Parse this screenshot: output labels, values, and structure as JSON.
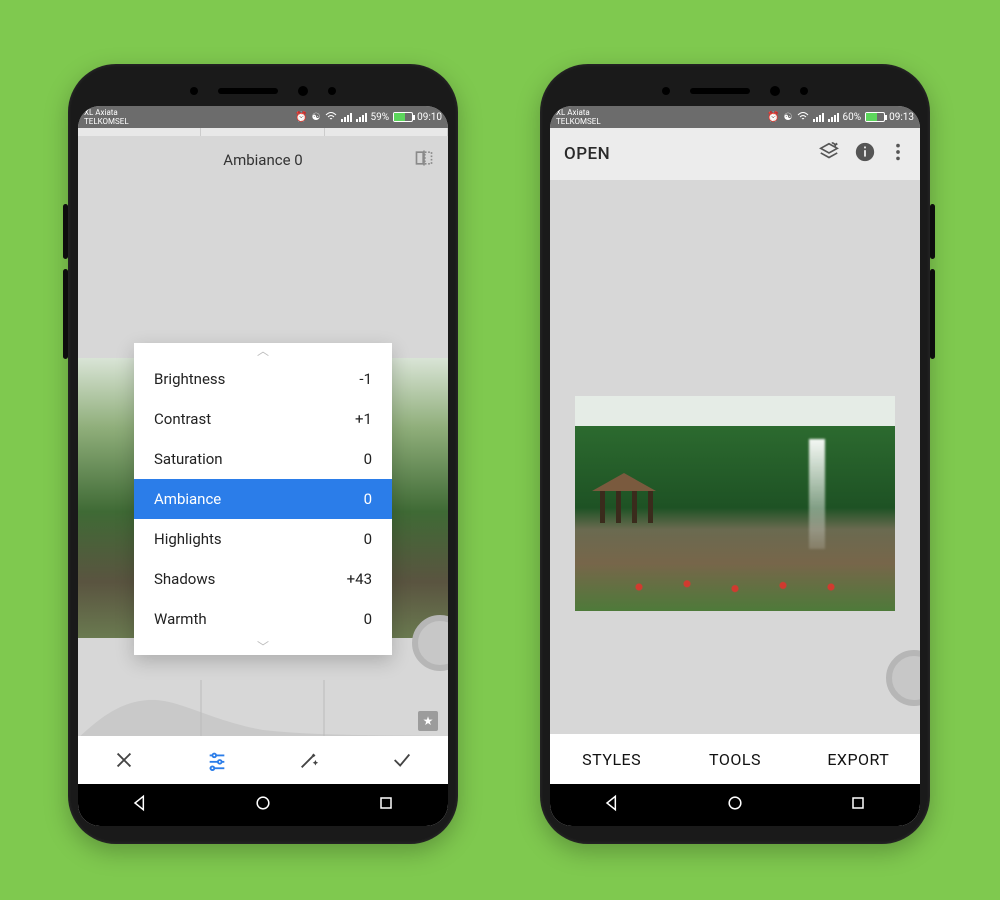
{
  "left": {
    "status": {
      "carrier1": "XL Axiata",
      "carrier2": "TELKOMSEL",
      "battery": "59%",
      "time": "09:10"
    },
    "header": {
      "title": "Ambiance 0"
    },
    "params": [
      {
        "label": "Brightness",
        "value": "-1",
        "selected": false
      },
      {
        "label": "Contrast",
        "value": "+1",
        "selected": false
      },
      {
        "label": "Saturation",
        "value": "0",
        "selected": false
      },
      {
        "label": "Ambiance",
        "value": "0",
        "selected": true
      },
      {
        "label": "Highlights",
        "value": "0",
        "selected": false
      },
      {
        "label": "Shadows",
        "value": "+43",
        "selected": false
      },
      {
        "label": "Warmth",
        "value": "0",
        "selected": false
      }
    ],
    "toolbar": {
      "close": "close",
      "tune": "tune",
      "magic": "magic",
      "apply": "apply"
    }
  },
  "right": {
    "status": {
      "carrier1": "XL Axiata",
      "carrier2": "TELKOMSEL",
      "battery": "60%",
      "time": "09:13"
    },
    "header": {
      "open": "OPEN"
    },
    "bottom": {
      "styles": "STYLES",
      "tools": "TOOLS",
      "export": "EXPORT"
    }
  }
}
